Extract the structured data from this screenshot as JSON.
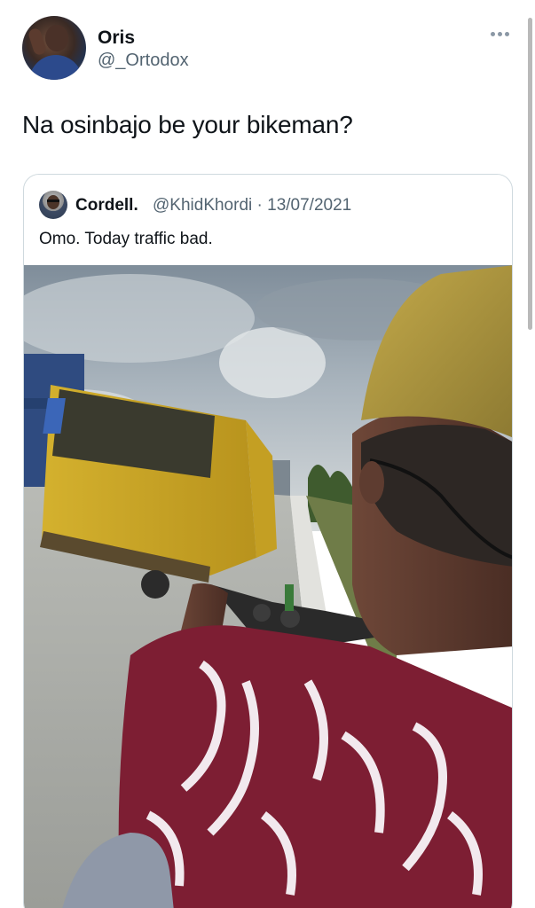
{
  "tweet": {
    "author": {
      "name": "Oris",
      "handle": "@_Ortodox"
    },
    "text": "Na osinbajo be your bikeman?",
    "more_icon": "ellipsis-icon"
  },
  "quoted_tweet": {
    "author": {
      "name": "Cordell.",
      "handle": "@KhidKhordi",
      "date": "13/07/2021"
    },
    "meta": "@KhidKhordi · 13/07/2021",
    "text": "Omo. Today traffic bad."
  },
  "colors": {
    "text_primary": "#0f1419",
    "text_secondary": "#536471",
    "border": "#cfd9de"
  }
}
